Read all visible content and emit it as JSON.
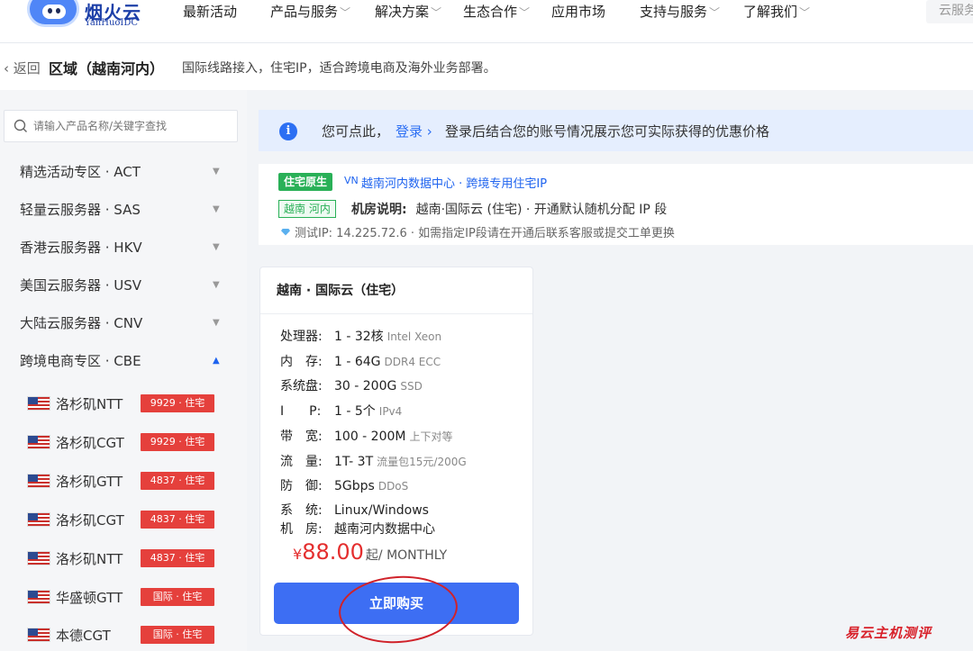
{
  "nav": {
    "logo_brand": "烟火云",
    "logo_sub": "YanHuoIDC",
    "items": [
      {
        "label": "最新活动",
        "has_dropdown": false
      },
      {
        "label": "产品与服务",
        "has_dropdown": true
      },
      {
        "label": "解决方案",
        "has_dropdown": true
      },
      {
        "label": "生态合作",
        "has_dropdown": true
      },
      {
        "label": "应用市场",
        "has_dropdown": false
      },
      {
        "label": "支持与服务",
        "has_dropdown": true
      },
      {
        "label": "了解我们",
        "has_dropdown": true
      }
    ],
    "search_placeholder": "云服务"
  },
  "region": {
    "back_label": "返回",
    "title": "区域（越南河内）",
    "description": "国际线路接入，住宅IP，适合跨境电商及海外业务部署。"
  },
  "sidebar": {
    "search_placeholder": "请输入产品名称/关键字查找",
    "categories": [
      {
        "label": "精选活动专区 · ACT",
        "open": false
      },
      {
        "label": "轻量云服务器 · SAS",
        "open": false
      },
      {
        "label": "香港云服务器 · HKV",
        "open": false
      },
      {
        "label": "美国云服务器 · USV",
        "open": false
      },
      {
        "label": "大陆云服务器 · CNV",
        "open": false
      },
      {
        "label": "跨境电商专区 · CBE",
        "open": true
      }
    ],
    "sub_items": [
      {
        "name": "洛杉矶NTT",
        "tag": "9929 · 住宅"
      },
      {
        "name": "洛杉矶CGT",
        "tag": "9929 · 住宅"
      },
      {
        "name": "洛杉矶GTT",
        "tag": "4837 · 住宅"
      },
      {
        "name": "洛杉矶CGT",
        "tag": "4837 · 住宅"
      },
      {
        "name": "洛杉矶NTT",
        "tag": "4837 · 住宅"
      },
      {
        "name": "华盛顿GTT",
        "tag": "国际 · 住宅"
      },
      {
        "name": "本德CGT",
        "tag": "国际 · 住宅"
      }
    ]
  },
  "notice": {
    "text_before": "您可点此，",
    "login_label": "登录 ›",
    "text_after": "登录后结合您的账号情况展示您可实际获得的优惠价格"
  },
  "info": {
    "badge_native": "住宅原生",
    "vn": "VN",
    "dc_link": "越南河内数据中心 · 跨境专用住宅IP",
    "badge_location": "越南 河内",
    "room_label": "机房说明:",
    "room_text": "越南·国际云 (住宅) · 开通默认随机分配 IP 段",
    "test_ip": "测试IP: 14.225.72.6 · 如需指定IP段请在开通后联系客服或提交工单更换"
  },
  "product": {
    "title": "越南 · 国际云（住宅）",
    "specs": [
      {
        "key": "处理器:",
        "value": "1 - 32核",
        "note": "Intel Xeon"
      },
      {
        "key": "内　存:",
        "value": "1 - 64G",
        "note": "DDR4 ECC"
      },
      {
        "key": "系统盘:",
        "value": "30 - 200G",
        "note": "SSD"
      },
      {
        "key": "I　　P:",
        "value": "1 - 5个",
        "note": "IPv4"
      },
      {
        "key": "带　宽:",
        "value": "100 - 200M",
        "note": "上下对等"
      },
      {
        "key": "流　量:",
        "value": "1T- 3T",
        "note": "流量包15元/200G"
      },
      {
        "key": "防　御:",
        "value": "5Gbps",
        "note": "DDoS"
      },
      {
        "key": "系　统:",
        "value": "Linux/Windows",
        "note": ""
      },
      {
        "key": "机　房:",
        "value": "越南河内数据中心",
        "note": ""
      }
    ],
    "currency": "¥",
    "price": "88.00",
    "period": "起/ MONTHLY",
    "buy_label": "立即购买"
  },
  "watermark": "易云主机测评",
  "colors": {
    "accent": "#3d6ef3",
    "tag_red": "#e5403c",
    "green": "#29b057",
    "price_red": "#e42e2e"
  }
}
